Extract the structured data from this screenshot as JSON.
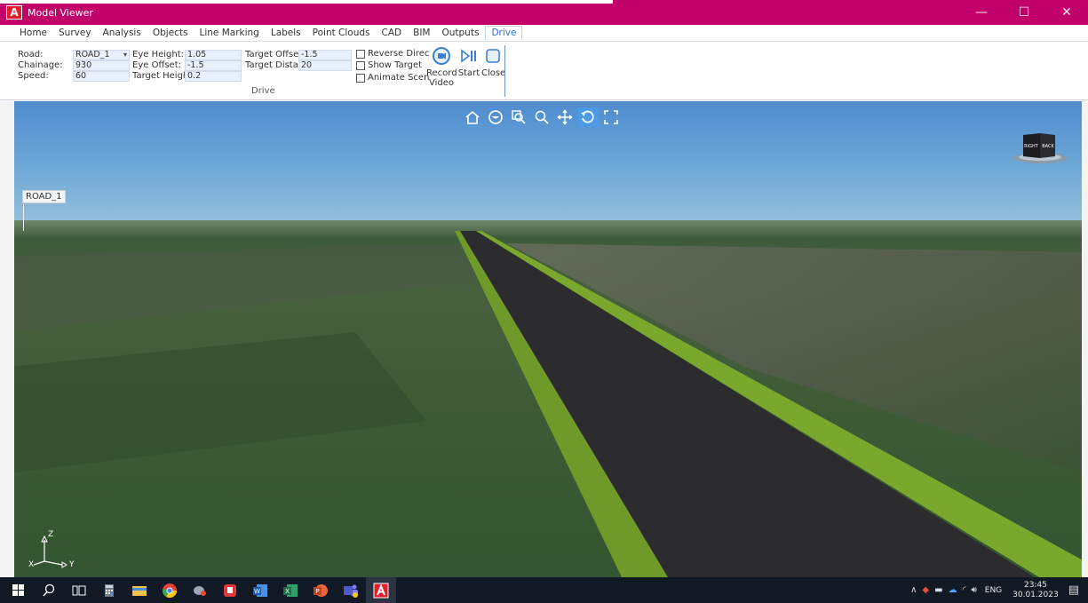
{
  "window": {
    "title": "Model Viewer",
    "logo_letter": "A",
    "minimize_glyph": "—",
    "maximize_glyph": "☐",
    "close_glyph": "✕"
  },
  "menu": {
    "tabs": [
      "Home",
      "Survey",
      "Analysis",
      "Objects",
      "Line Marking",
      "Labels",
      "Point Clouds",
      "CAD",
      "BIM",
      "Outputs",
      "Drive"
    ],
    "active_tab": "Drive"
  },
  "ribbon": {
    "road_label": "Road:",
    "road_value": "ROAD_1",
    "chainage_label": "Chainage:",
    "chainage_value": "930",
    "speed_label": "Speed:",
    "speed_value": "60",
    "eye_height_label": "Eye Height:",
    "eye_height_value": "1.05",
    "eye_offset_label": "Eye Offset:",
    "eye_offset_value": "-1.5",
    "target_height_label": "Target Height:",
    "target_height_value": "0.2",
    "target_offset_label": "Target Offset:",
    "target_offset_value": "-1.5",
    "target_distance_label": "Target Distanc",
    "target_distance_value": "20",
    "reverse_direction_label": "Reverse Directi",
    "show_target_label": "Show Target",
    "animate_scene_label": "Animate Scene",
    "record_video_line1": "Record",
    "record_video_line2": "Video",
    "start_label": "Start",
    "close_label": "Close",
    "group_caption": "Drive"
  },
  "viewport": {
    "road_name_label": "ROAD_1",
    "viewcube_right": "RIGHT",
    "viewcube_back": "BACK",
    "axis_z": "Z",
    "axis_x": "X",
    "axis_y": "Y"
  },
  "taskbar": {
    "language": "ENG",
    "time": "23:45",
    "date": "30.01.2023"
  },
  "colors": {
    "titlebar": "#c2006a",
    "accent_blue": "#2f6fd0",
    "taskbar": "#111a24"
  }
}
